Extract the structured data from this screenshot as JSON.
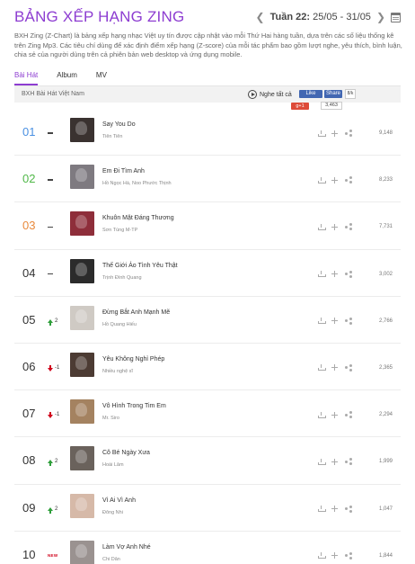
{
  "header": {
    "title": "BẢNG XẾP HẠNG ZING",
    "week_label": "Tuần 22:",
    "week_range": "25/05 - 31/05"
  },
  "description": "BXH Zing (Z-Chart) là bảng xếp hạng nhạc Việt uy tín được cập nhật vào mỗi Thứ Hai hàng tuần, dựa trên các số liệu thống kê trên Zing Mp3. Các tiêu chí dùng để xác định điểm xếp hạng (Z-score) của mỗi tác phẩm bao gồm lượt nghe, yêu thích, bình luận, chia sẻ của người dùng trên cả phiên bản web desktop và ứng dụng mobile.",
  "tabs": [
    {
      "label": "Bài Hát",
      "active": true
    },
    {
      "label": "Album",
      "active": false
    },
    {
      "label": "MV",
      "active": false
    }
  ],
  "list_header": {
    "title": "BXH Bài Hát Việt Nam",
    "play_all": "Nghe tất cả",
    "fb_like": "Like",
    "fb_share": "Share",
    "fb_count": "8/k",
    "gplus": "g+1",
    "gplus_count": "3,463"
  },
  "songs": [
    {
      "rank": "01",
      "change_type": "same",
      "change": "",
      "title": "Say You Do",
      "artist": "Tiên Tiên",
      "score": "9,148",
      "thumb": "#3a3230"
    },
    {
      "rank": "02",
      "change_type": "same",
      "change": "",
      "title": "Em Đi Tìm Anh",
      "artist": "Hồ Ngọc Hà, Noo Phước Thịnh",
      "score": "8,233",
      "thumb": "#7e7a80"
    },
    {
      "rank": "03",
      "change_type": "same",
      "change": "",
      "title": "Khuôn Mặt Đáng Thương",
      "artist": "Sơn Tùng M-TP",
      "score": "7,731",
      "thumb": "#8e2e3a"
    },
    {
      "rank": "04",
      "change_type": "same",
      "change": "",
      "title": "Thế Giới Ảo Tình Yêu Thật",
      "artist": "Trịnh Đình Quang",
      "score": "3,002",
      "thumb": "#2b2b2b"
    },
    {
      "rank": "05",
      "change_type": "up",
      "change": "2",
      "title": "Đừng Bắt Anh Mạnh Mẽ",
      "artist": "Hồ Quang Hiếu",
      "score": "2,766",
      "thumb": "#cfcac4"
    },
    {
      "rank": "06",
      "change_type": "down",
      "change": "-1",
      "title": "Yêu Không Nghỉ Phép",
      "artist": "Nhiều nghệ sĩ",
      "score": "2,365",
      "thumb": "#4c3b33"
    },
    {
      "rank": "07",
      "change_type": "down",
      "change": "-1",
      "title": "Vô Hình Trong Tim Em",
      "artist": "Mr. Siro",
      "score": "2,294",
      "thumb": "#a48260"
    },
    {
      "rank": "08",
      "change_type": "up",
      "change": "2",
      "title": "Cô Bé Ngày Xưa",
      "artist": "Hoài Lâm",
      "score": "1,999",
      "thumb": "#6a625c"
    },
    {
      "rank": "09",
      "change_type": "up",
      "change": "2",
      "title": "Vì Ai Vì Anh",
      "artist": "Đông Nhi",
      "score": "1,047",
      "thumb": "#d6b9a8"
    },
    {
      "rank": "10",
      "change_type": "new",
      "change": "NEW",
      "title": "Làm Vợ Anh Nhé",
      "artist": "Chi Dân",
      "score": "1,844",
      "thumb": "#9a9290"
    }
  ],
  "colors": {
    "accent": "#8d3dd1",
    "rank1": "#4a90e2",
    "rank2": "#50b848",
    "rank3": "#e98a3c",
    "up": "#2e9e3a",
    "down": "#d0021b"
  }
}
